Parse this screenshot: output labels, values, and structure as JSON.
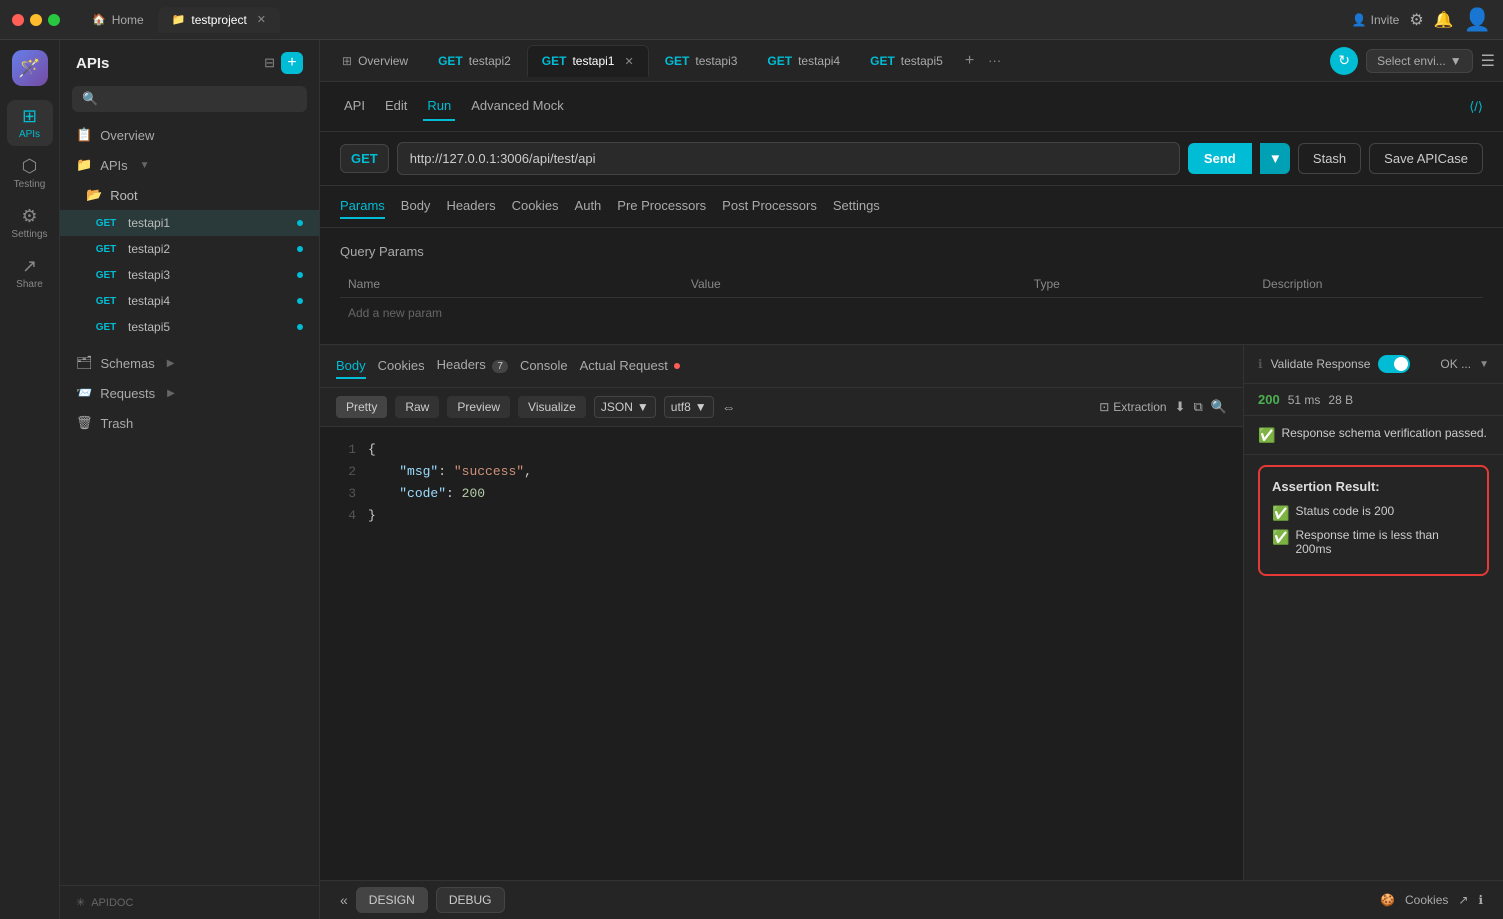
{
  "app": {
    "logo": "🪄",
    "traffic_lights": [
      "red",
      "yellow",
      "green"
    ]
  },
  "titlebar": {
    "tabs": [
      {
        "label": "Home",
        "icon": "🏠",
        "active": false
      },
      {
        "label": "testproject",
        "icon": "📁",
        "active": true,
        "closeable": true
      }
    ],
    "right": {
      "invite_label": "Invite",
      "settings_icon": "⚙",
      "bell_icon": "🔔",
      "avatar_icon": "👤"
    }
  },
  "icon_sidebar": {
    "items": [
      {
        "id": "apis",
        "icon": "⊞",
        "label": "APIs",
        "active": true
      },
      {
        "id": "testing",
        "icon": "⬡",
        "label": "Testing",
        "active": false
      },
      {
        "id": "settings",
        "icon": "⚙",
        "label": "Settings",
        "active": false
      },
      {
        "id": "share",
        "icon": "↗",
        "label": "Share",
        "active": false
      }
    ]
  },
  "nav_sidebar": {
    "title": "APIs",
    "overview_label": "Overview",
    "apis_label": "APIs",
    "root_label": "Root",
    "apis": [
      {
        "method": "GET",
        "name": "testapi1",
        "active": true,
        "dot": true
      },
      {
        "method": "GET",
        "name": "testapi2",
        "dot": true
      },
      {
        "method": "GET",
        "name": "testapi3",
        "dot": true
      },
      {
        "method": "GET",
        "name": "testapi4",
        "dot": true
      },
      {
        "method": "GET",
        "name": "testapi5",
        "dot": true
      }
    ],
    "schemas_label": "Schemas",
    "requests_label": "Requests",
    "trash_label": "Trash",
    "footer_label": "APIDOC"
  },
  "tabs": [
    {
      "label": "Overview",
      "method": null,
      "active": false
    },
    {
      "label": "testapi2",
      "method": "GET",
      "active": false
    },
    {
      "label": "testapi1",
      "method": "GET",
      "active": true
    },
    {
      "label": "testapi3",
      "method": "GET",
      "active": false
    },
    {
      "label": "testapi4",
      "method": "GET",
      "active": false
    },
    {
      "label": "testapi5",
      "method": "GET",
      "active": false
    }
  ],
  "api_toolbar": {
    "tabs": [
      {
        "label": "API",
        "active": false
      },
      {
        "label": "Edit",
        "active": false
      },
      {
        "label": "Run",
        "active": true
      },
      {
        "label": "Advanced Mock",
        "active": false
      }
    ]
  },
  "url_bar": {
    "method": "GET",
    "url": "http://127.0.0.1:3006/api/test/api",
    "send_label": "Send",
    "stash_label": "Stash",
    "save_label": "Save APICase"
  },
  "params_tabs": {
    "tabs": [
      {
        "label": "Params",
        "active": true
      },
      {
        "label": "Body",
        "active": false
      },
      {
        "label": "Headers",
        "active": false
      },
      {
        "label": "Cookies",
        "active": false
      },
      {
        "label": "Auth",
        "active": false
      },
      {
        "label": "Pre Processors",
        "active": false
      },
      {
        "label": "Post Processors",
        "active": false
      },
      {
        "label": "Settings",
        "active": false
      }
    ]
  },
  "params_table": {
    "title": "Query Params",
    "headers": [
      "Name",
      "Value",
      "Type",
      "Description"
    ],
    "add_placeholder": "Add a new param"
  },
  "response_tabs": {
    "tabs": [
      {
        "label": "Body",
        "active": true
      },
      {
        "label": "Cookies",
        "active": false
      },
      {
        "label": "Headers",
        "badge": "7",
        "active": false
      },
      {
        "label": "Console",
        "active": false
      },
      {
        "label": "Actual Request",
        "dot": true,
        "active": false
      }
    ]
  },
  "response_toolbar": {
    "format_buttons": [
      {
        "label": "Pretty",
        "active": true
      },
      {
        "label": "Raw",
        "active": false
      },
      {
        "label": "Preview",
        "active": false
      },
      {
        "label": "Visualize",
        "active": false
      }
    ],
    "format": "JSON",
    "encoding": "utf8",
    "extraction_label": "Extraction"
  },
  "response_code": {
    "lines": [
      {
        "num": "1",
        "content": "{"
      },
      {
        "num": "2",
        "content": "  \"msg\": \"success\","
      },
      {
        "num": "3",
        "content": "  \"code\": 200"
      },
      {
        "num": "4",
        "content": "}"
      }
    ]
  },
  "validate_response": {
    "label": "Validate Response",
    "toggle_on": true,
    "ok_label": "OK ...",
    "status_code": "200",
    "time": "51 ms",
    "size": "28 B",
    "schema_msg": "Response schema verification passed.",
    "assertion": {
      "title": "Assertion Result:",
      "items": [
        {
          "text": "Status code is 200"
        },
        {
          "text": "Response time is less than 200ms"
        }
      ]
    }
  },
  "bottom_bar": {
    "chevron_left": "«",
    "design_label": "DESIGN",
    "debug_label": "DEBUG",
    "cookies_label": "Cookies",
    "share_icon": "↗",
    "info_icon": "ℹ"
  }
}
